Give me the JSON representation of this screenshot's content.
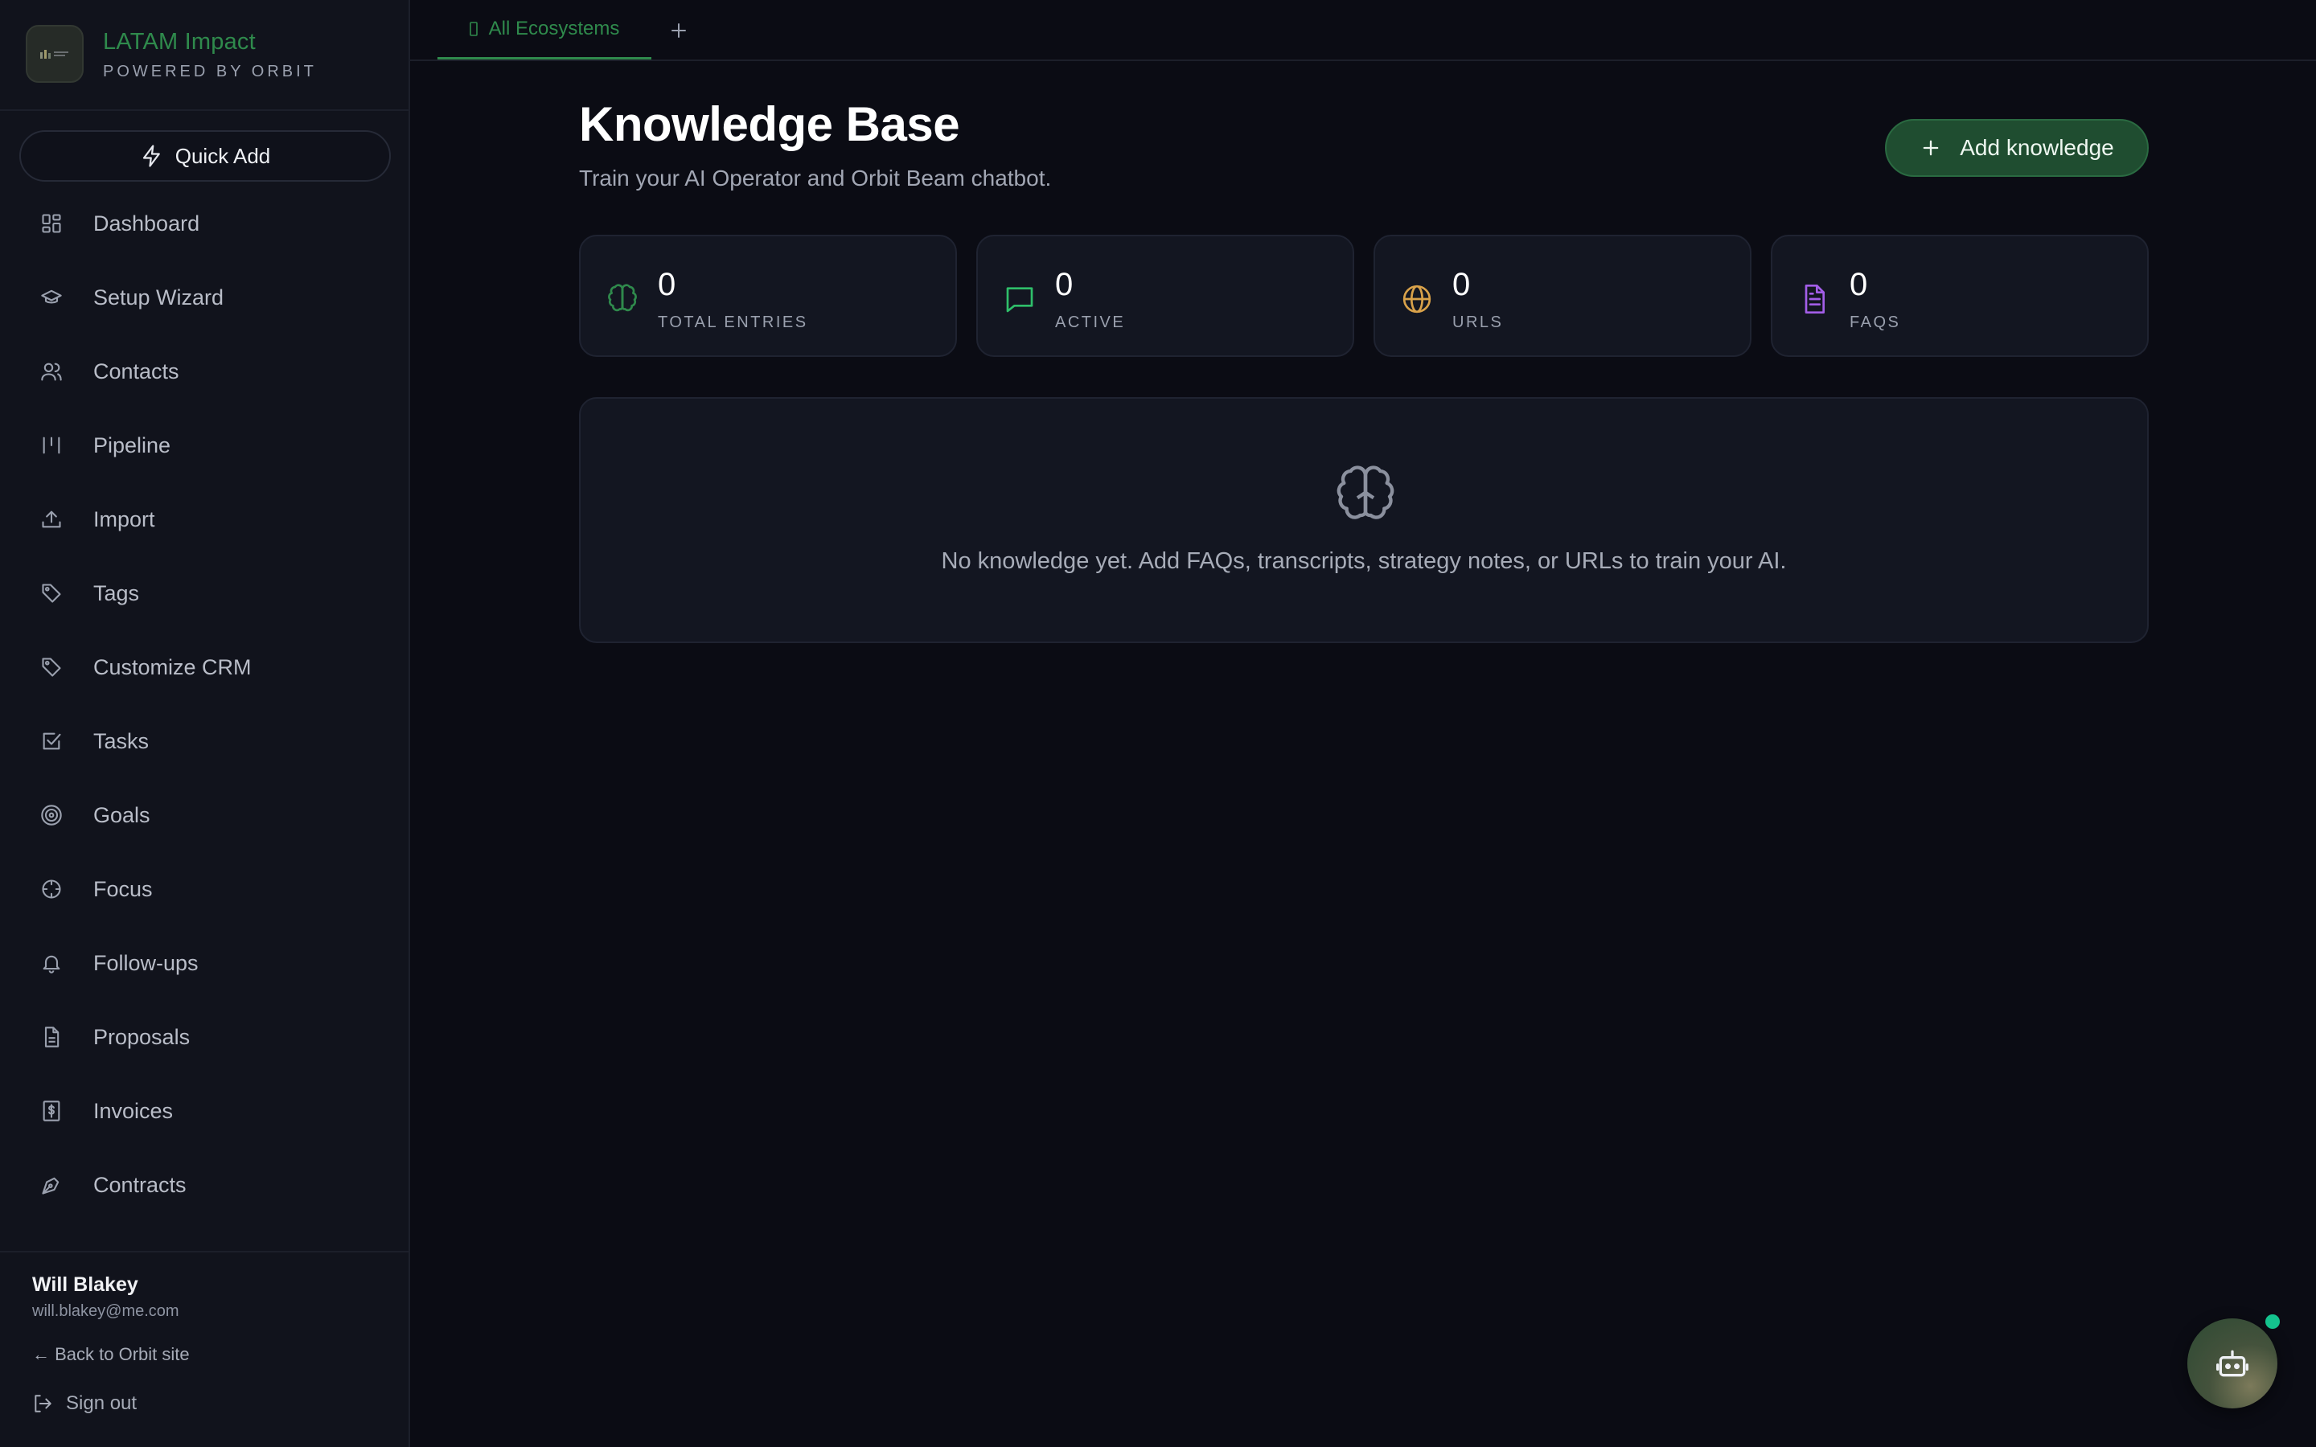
{
  "brand": {
    "name": "LATAM Impact",
    "subtitle": "POWERED BY ORBIT"
  },
  "quick_add": {
    "label": "Quick Add",
    "icon": "bolt-icon"
  },
  "nav": {
    "items": [
      {
        "label": "Dashboard",
        "icon": "grid-icon"
      },
      {
        "label": "Setup Wizard",
        "icon": "graduation-cap-icon"
      },
      {
        "label": "Contacts",
        "icon": "users-icon"
      },
      {
        "label": "Pipeline",
        "icon": "pipeline-icon"
      },
      {
        "label": "Import",
        "icon": "upload-icon"
      },
      {
        "label": "Tags",
        "icon": "tag-icon"
      },
      {
        "label": "Customize CRM",
        "icon": "tag-icon"
      },
      {
        "label": "Tasks",
        "icon": "checkbox-icon"
      },
      {
        "label": "Goals",
        "icon": "target-icon"
      },
      {
        "label": "Focus",
        "icon": "crosshair-icon"
      },
      {
        "label": "Follow-ups",
        "icon": "bell-icon"
      },
      {
        "label": "Proposals",
        "icon": "document-icon"
      },
      {
        "label": "Invoices",
        "icon": "dollar-receipt-icon"
      },
      {
        "label": "Contracts",
        "icon": "pen-icon"
      }
    ]
  },
  "user": {
    "name": "Will Blakey",
    "email": "will.blakey@me.com",
    "back_link": "← Back to Orbit site",
    "sign_out": "Sign out"
  },
  "tabs": [
    {
      "label": "All Ecosystems",
      "active": true
    }
  ],
  "header": {
    "title": "Knowledge Base",
    "subtitle": "Train your AI Operator and Orbit Beam chatbot.",
    "add_button": "Add knowledge"
  },
  "stats": [
    {
      "value": "0",
      "label": "TOTAL ENTRIES",
      "icon": "brain-icon",
      "color": "#2f8a4c"
    },
    {
      "value": "0",
      "label": "ACTIVE",
      "icon": "chat-icon",
      "color": "#2fbf6a"
    },
    {
      "value": "0",
      "label": "URLS",
      "icon": "globe-icon",
      "color": "#d9a24a"
    },
    {
      "value": "0",
      "label": "FAQS",
      "icon": "file-text-icon",
      "color": "#a35ee8"
    }
  ],
  "empty_state": {
    "icon": "brain-icon",
    "message": "No knowledge yet. Add FAQs, transcripts, strategy notes, or URLs to train your AI."
  },
  "assistant_fab": {
    "icon": "bot-icon",
    "status_color": "#14c38e"
  },
  "colors": {
    "accent": "#2f8a4c",
    "background": "#0b0c14",
    "sidebar": "#11131c"
  }
}
